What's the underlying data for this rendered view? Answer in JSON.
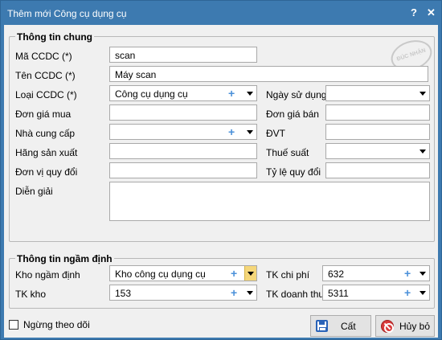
{
  "window": {
    "title": "Thêm mới Công cụ dụng cụ",
    "help": "?",
    "close": "✕"
  },
  "stamp": {
    "text": "ĐÚC NHẬN"
  },
  "general": {
    "legend": "Thông tin chung",
    "ma_ccdc": {
      "label": "Mã CCDC (*)",
      "value": "scan"
    },
    "ten_ccdc": {
      "label": "Tên CCDC (*)",
      "value": "Máy scan"
    },
    "loai_ccdc": {
      "label": "Loại CCDC (*)",
      "value": "Công cụ dụng cụ"
    },
    "ngay_su_dung": {
      "label": "Ngày sử dụng",
      "value": ""
    },
    "don_gia_mua": {
      "label": "Đơn giá mua",
      "value": ""
    },
    "don_gia_ban": {
      "label": "Đơn giá bán",
      "value": ""
    },
    "nha_cung_cap": {
      "label": "Nhà cung cấp",
      "value": ""
    },
    "dvt": {
      "label": "ĐVT",
      "value": ""
    },
    "hang_san_xuat": {
      "label": "Hãng sản xuất",
      "value": ""
    },
    "thue_suat": {
      "label": "Thuế suất",
      "value": ""
    },
    "don_vi_quy_doi": {
      "label": "Đơn vị quy đổi",
      "value": ""
    },
    "ty_le_quy_doi": {
      "label": "Tỷ lệ quy đổi",
      "value": ""
    },
    "dien_giai": {
      "label": "Diễn giải",
      "value": ""
    }
  },
  "defaults": {
    "legend": "Thông tin ngầm định",
    "kho_ngam_dinh": {
      "label": "Kho ngầm định",
      "value": "Kho công cụ dụng cụ"
    },
    "tk_chi_phi": {
      "label": "TK chi phí",
      "value": "632"
    },
    "tk_kho": {
      "label": "TK kho",
      "value": "153"
    },
    "tk_doanh_thu": {
      "label": "TK doanh thu",
      "value": "5311"
    }
  },
  "footer": {
    "stop_tracking_label": "Ngừng theo dõi",
    "save_label": "Cất",
    "cancel_label": "Hủy bỏ"
  },
  "icons": {
    "plus": "+",
    "accent": "#4a90d9"
  }
}
